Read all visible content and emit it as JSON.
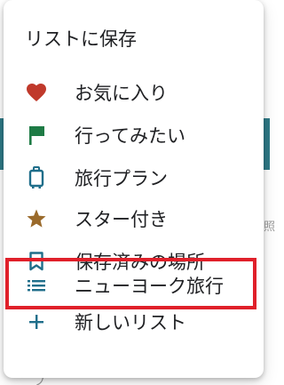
{
  "menu": {
    "title": "リストに保存",
    "items": [
      {
        "label": "お気に入り",
        "icon": "heart-icon",
        "color": "#c0392b"
      },
      {
        "label": "行ってみたい",
        "icon": "flag-icon",
        "color": "#1e7b45"
      },
      {
        "label": "旅行プラン",
        "icon": "suitcase-icon",
        "color": "#1f6e8a"
      },
      {
        "label": "スター付き",
        "icon": "star-icon",
        "color": "#9a6a2b"
      },
      {
        "label": "保存済みの場所",
        "icon": "bookmark-icon",
        "color": "#1f6e8a"
      },
      {
        "label": "ニューヨーク旅行",
        "icon": "list-icon",
        "color": "#1f6e8a",
        "highlighted": true
      },
      {
        "label": "新しいリスト",
        "icon": "plus-icon",
        "color": "#1f6e8a"
      }
    ]
  },
  "background": {
    "right_glyph": "照",
    "bottom_glyph": "フ"
  }
}
